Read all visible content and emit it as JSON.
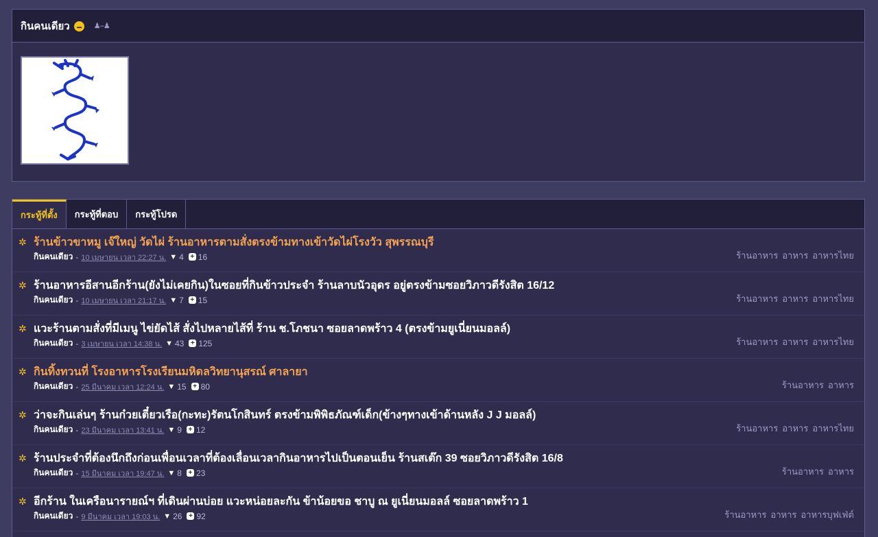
{
  "profile": {
    "name": "กินคนเดียว",
    "mood_icon": "smiley-icon",
    "follow_icon": "follow-users-icon",
    "follow_glyph": "♟--♟"
  },
  "tabs": [
    {
      "label": "กระทู้ที่ตั้ง",
      "active": true
    },
    {
      "label": "กระทู้ที่ตอบ",
      "active": false
    },
    {
      "label": "กระทู้โปรด",
      "active": false
    }
  ],
  "topics": [
    {
      "title": "ร้านข้าวขาหมู เจ๊ใหญ่ วัดไผ่ ร้านอาหารตามสั่งตรงข้ามทางเข้าวัดไผ่โรงวัว สุพรรณบุรี",
      "highlight": true,
      "author": "กินคนเดียว",
      "date": "10 เมษายน เวลา 22:27 น.",
      "comments": "4",
      "votes": "16",
      "tags": [
        "ร้านอาหาร",
        "อาหาร",
        "อาหารไทย"
      ]
    },
    {
      "title": "ร้านอาหารอีสานอีกร้าน(ยังไม่เคยกิน)ในซอยที่กินข้าวประจำ ร้านลาบนัวอุดร อยู่ตรงข้ามซอยวิภาวดีรังสิต 16/12",
      "highlight": false,
      "author": "กินคนเดียว",
      "date": "10 เมษายน เวลา 21:17 น.",
      "comments": "7",
      "votes": "15",
      "tags": [
        "ร้านอาหาร",
        "อาหาร",
        "อาหารไทย"
      ]
    },
    {
      "title": "แวะร้านตามสั่งที่มีเมนู ไข่ยัดไส้ สั่งไปหลายไส้ที่ ร้าน ช.โภชนา ซอยลาดพร้าว 4 (ตรงข้ามยูเนี่ยนมอลล์)",
      "highlight": false,
      "author": "กินคนเดียว",
      "date": "3 เมษายน เวลา 14:38 น.",
      "comments": "43",
      "votes": "125",
      "tags": [
        "ร้านอาหาร",
        "อาหาร",
        "อาหารไทย"
      ]
    },
    {
      "title": "กินทิ้งทวนที่ โรงอาหารโรงเรียนมหิดลวิทยานุสรณ์ ศาลายา",
      "highlight": true,
      "author": "กินคนเดียว",
      "date": "25 มีนาคม เวลา 12:24 น.",
      "comments": "15",
      "votes": "80",
      "tags": [
        "ร้านอาหาร",
        "อาหาร"
      ]
    },
    {
      "title": "ว่าจะกินเล่นๆ ร้านก๋วยเตี๋ยวเรือ(กะทะ)รัตนโกสินทร์ ตรงข้ามพิพิธภัณฑ์เด็ก(ข้างๆทางเข้าด้านหลัง J J มอลล์)",
      "highlight": false,
      "author": "กินคนเดียว",
      "date": "23 มีนาคม เวลา 13:41 น.",
      "comments": "9",
      "votes": "12",
      "tags": [
        "ร้านอาหาร",
        "อาหาร",
        "อาหารไทย"
      ]
    },
    {
      "title": "ร้านประจำที่ต้องนึกถึงก่อนเพื่อนเวลาที่ต้องเลื่อนเวลากินอาหารไปเป็นตอนเย็น ร้านสเต๊ก 39 ซอยวิภาวดีรังสิต 16/8",
      "highlight": false,
      "author": "กินคนเดียว",
      "date": "15 มีนาคม เวลา 19:47 น.",
      "comments": "8",
      "votes": "23",
      "tags": [
        "ร้านอาหาร",
        "อาหาร"
      ]
    },
    {
      "title": "อีกร้าน ในเครือนารายณ์ฯ ที่เดินผ่านบ่อย แวะหน่อยละกัน ข้าน้อยขอ ชาบู ณ ยูเนี่ยนมอลล์ ซอยลาดพร้าว 1",
      "highlight": false,
      "author": "กินคนเดียว",
      "date": "9 มีนาคม เวลา 19:03 น.",
      "comments": "26",
      "votes": "92",
      "tags": [
        "ร้านอาหาร",
        "อาหาร",
        "อาหารบุฟเฟ่ต์"
      ]
    }
  ],
  "icons": {
    "topic": "star-icon",
    "comment": "comment-icon",
    "vote": "plus-vote-icon"
  },
  "meta_separator": "-",
  "colors": {
    "background": "#3f3c62",
    "panel": "#2f2c4d",
    "header": "#221f3a",
    "accent": "#f2c21b",
    "highlight_title": "#f4a352",
    "tag": "#9d9ac7"
  }
}
